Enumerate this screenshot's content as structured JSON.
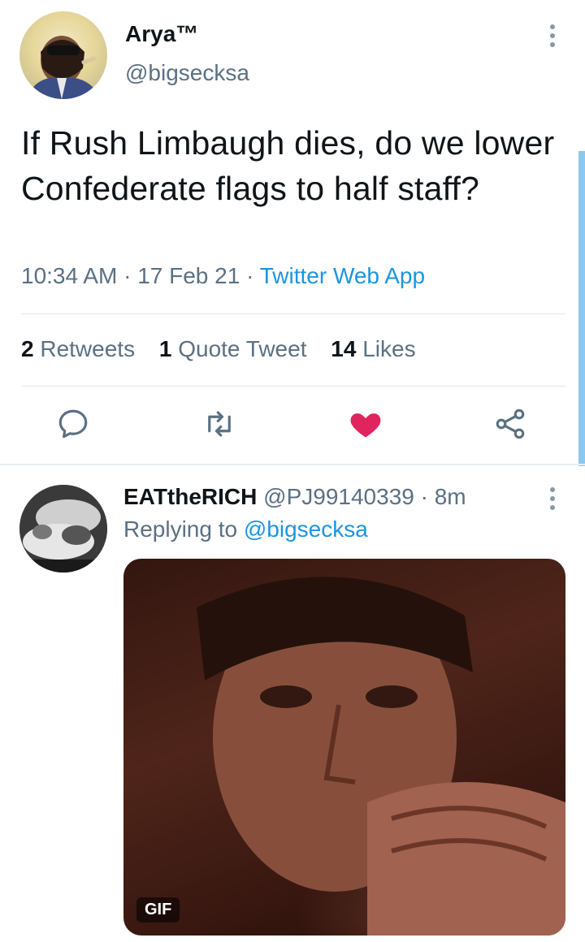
{
  "main_tweet": {
    "author_name": "Arya™",
    "author_handle": "@bigsecksa",
    "text": "If Rush Limbaugh dies, do we lower Confederate flags to half staff?",
    "time": "10:34 AM",
    "date": "17 Feb 21",
    "source": "Twitter Web App",
    "retweets_count": "2",
    "retweets_label": "Retweets",
    "quotes_count": "1",
    "quotes_label": "Quote Tweet",
    "likes_count": "14",
    "likes_label": "Likes",
    "liked": true,
    "actions": [
      "reply-icon",
      "retweet-icon",
      "heart-icon",
      "share-icon"
    ]
  },
  "reply": {
    "author_name": "EATtheRICH",
    "author_handle": "@PJ99140339",
    "time": "8m",
    "replying_prefix": "Replying to",
    "replying_to": "@bigsecksa",
    "media_badge": "GIF"
  },
  "colors": {
    "text": "#0f1419",
    "secondary": "#5b7083",
    "link": "#1b95e0",
    "like": "#e0245e",
    "divider": "#e1e8ed"
  }
}
